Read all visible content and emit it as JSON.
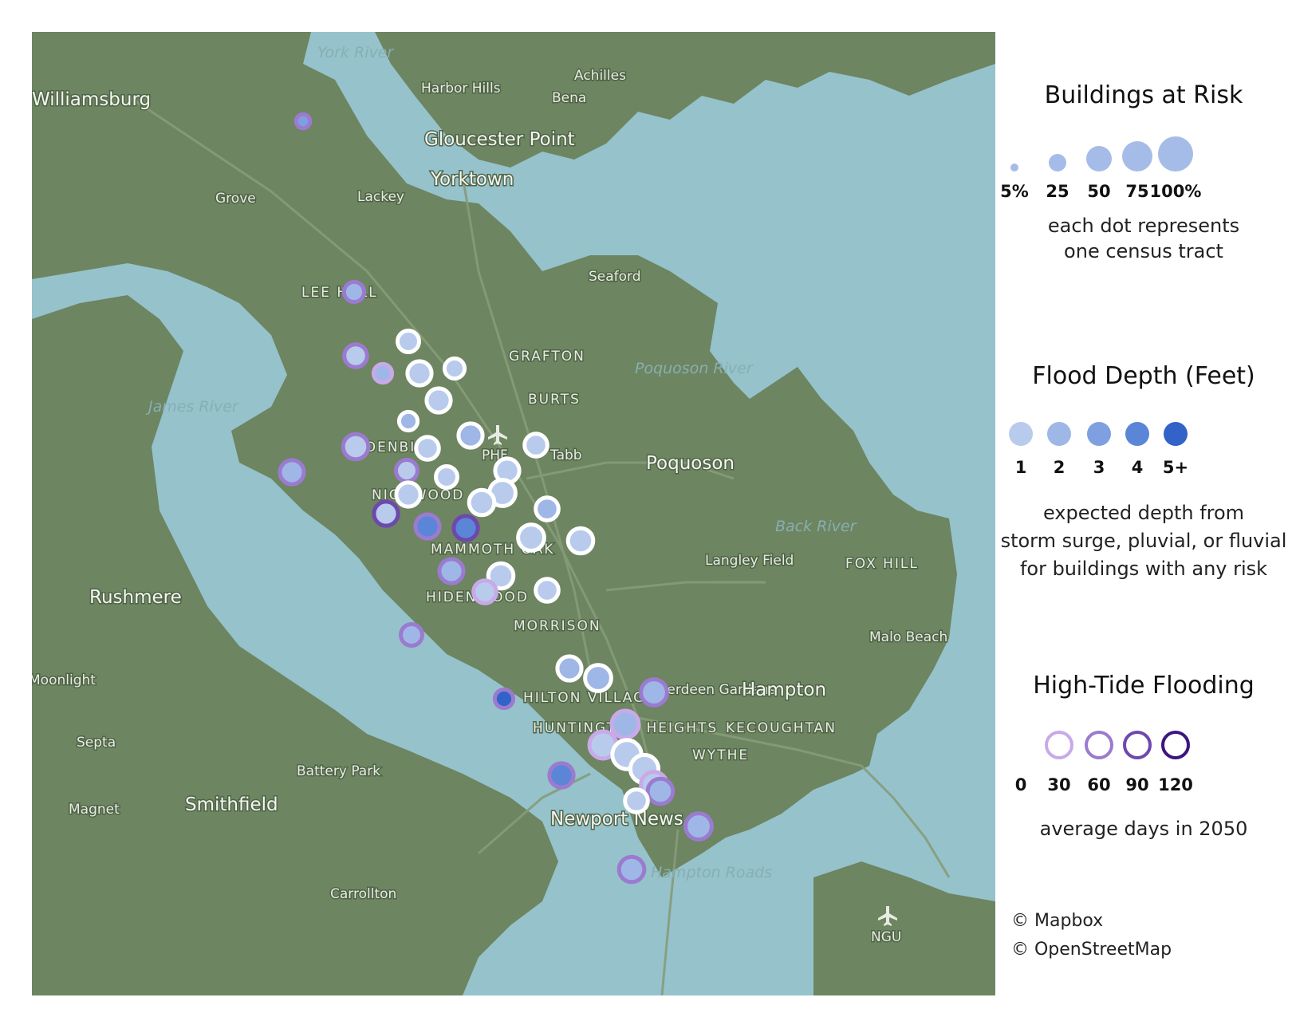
{
  "map": {
    "colors": {
      "water": "#95c2cb",
      "land": "#6d8560",
      "roads": "#869c7a",
      "label": "#e7ece2"
    },
    "place_labels": [
      {
        "text": "York River",
        "kind": "water"
      },
      {
        "text": "Harbor Hills",
        "kind": "town"
      },
      {
        "text": "Achilles",
        "kind": "town"
      },
      {
        "text": "Williamsburg",
        "kind": "town"
      },
      {
        "text": "Bena",
        "kind": "town"
      },
      {
        "text": "Gloucester Point",
        "kind": "town"
      },
      {
        "text": "Yorktown",
        "kind": "town"
      },
      {
        "text": "Grove",
        "kind": "town"
      },
      {
        "text": "Lackey",
        "kind": "town"
      },
      {
        "text": "Seaford",
        "kind": "town"
      },
      {
        "text": "LEE HALL",
        "kind": "district"
      },
      {
        "text": "GRAFTON",
        "kind": "district"
      },
      {
        "text": "Poquoson River",
        "kind": "water"
      },
      {
        "text": "James River",
        "kind": "water"
      },
      {
        "text": "BURTS",
        "kind": "district"
      },
      {
        "text": "DENBIGH",
        "kind": "district"
      },
      {
        "text": "PHF",
        "kind": "airport"
      },
      {
        "text": "Tabb",
        "kind": "town"
      },
      {
        "text": "Poquoson",
        "kind": "city"
      },
      {
        "text": "NIGHWOOD",
        "kind": "district"
      },
      {
        "text": "Back River",
        "kind": "water"
      },
      {
        "text": "MAMMOTH OAK",
        "kind": "district"
      },
      {
        "text": "Langley Field",
        "kind": "town"
      },
      {
        "text": "FOX HILL",
        "kind": "district"
      },
      {
        "text": "Rushmere",
        "kind": "town"
      },
      {
        "text": "HIDENWOOD",
        "kind": "district"
      },
      {
        "text": "MORRISON",
        "kind": "district"
      },
      {
        "text": "Malo Beach",
        "kind": "town"
      },
      {
        "text": "Moonlight",
        "kind": "town"
      },
      {
        "text": "Aberdeen Gardens",
        "kind": "town"
      },
      {
        "text": "HILTON VILLAGE",
        "kind": "district"
      },
      {
        "text": "Hampton",
        "kind": "city"
      },
      {
        "text": "HUNTINGTON HEIGHTS",
        "kind": "district"
      },
      {
        "text": "KECOUGHTAN",
        "kind": "district"
      },
      {
        "text": "Septa",
        "kind": "town"
      },
      {
        "text": "WYTHE",
        "kind": "district"
      },
      {
        "text": "Battery Park",
        "kind": "town"
      },
      {
        "text": "Magnet",
        "kind": "town"
      },
      {
        "text": "Smithfield",
        "kind": "town"
      },
      {
        "text": "Newport News",
        "kind": "city"
      },
      {
        "text": "Hampton Roads",
        "kind": "water"
      },
      {
        "text": "Carrollton",
        "kind": "town"
      },
      {
        "text": "NGU",
        "kind": "airport"
      }
    ],
    "tracts": [
      {
        "buildings_pct": 5,
        "depth_ft": 3,
        "tide_days": 60
      },
      {
        "buildings_pct": 20,
        "depth_ft": 2,
        "tide_days": 60
      },
      {
        "buildings_pct": 25,
        "depth_ft": 1,
        "tide_days": 0
      },
      {
        "buildings_pct": 30,
        "depth_ft": 1,
        "tide_days": 60
      },
      {
        "buildings_pct": 15,
        "depth_ft": 2,
        "tide_days": 30
      },
      {
        "buildings_pct": 35,
        "depth_ft": 1,
        "tide_days": 0
      },
      {
        "buildings_pct": 20,
        "depth_ft": 1,
        "tide_days": 0
      },
      {
        "buildings_pct": 35,
        "depth_ft": 1,
        "tide_days": 0
      },
      {
        "buildings_pct": 15,
        "depth_ft": 2,
        "tide_days": 0
      },
      {
        "buildings_pct": 40,
        "depth_ft": 1,
        "tide_days": 60
      },
      {
        "buildings_pct": 30,
        "depth_ft": 1,
        "tide_days": 0
      },
      {
        "buildings_pct": 35,
        "depth_ft": 2,
        "tide_days": 0
      },
      {
        "buildings_pct": 30,
        "depth_ft": 1,
        "tide_days": 0
      },
      {
        "buildings_pct": 35,
        "depth_ft": 1,
        "tide_days": 0
      },
      {
        "buildings_pct": 35,
        "depth_ft": 2,
        "tide_days": 60
      },
      {
        "buildings_pct": 25,
        "depth_ft": 1,
        "tide_days": 60
      },
      {
        "buildings_pct": 25,
        "depth_ft": 1,
        "tide_days": 0
      },
      {
        "buildings_pct": 35,
        "depth_ft": 1,
        "tide_days": 0
      },
      {
        "buildings_pct": 45,
        "depth_ft": 1,
        "tide_days": 0
      },
      {
        "buildings_pct": 40,
        "depth_ft": 1,
        "tide_days": 0
      },
      {
        "buildings_pct": 35,
        "depth_ft": 1,
        "tide_days": 90
      },
      {
        "buildings_pct": 35,
        "depth_ft": 4,
        "tide_days": 60
      },
      {
        "buildings_pct": 35,
        "depth_ft": 4,
        "tide_days": 90
      },
      {
        "buildings_pct": 30,
        "depth_ft": 2,
        "tide_days": 0
      },
      {
        "buildings_pct": 45,
        "depth_ft": 1,
        "tide_days": 0
      },
      {
        "buildings_pct": 40,
        "depth_ft": 1,
        "tide_days": 0
      },
      {
        "buildings_pct": 35,
        "depth_ft": 2,
        "tide_days": 60
      },
      {
        "buildings_pct": 40,
        "depth_ft": 1,
        "tide_days": 0
      },
      {
        "buildings_pct": 30,
        "depth_ft": 1,
        "tide_days": 30
      },
      {
        "buildings_pct": 30,
        "depth_ft": 1,
        "tide_days": 0
      },
      {
        "buildings_pct": 25,
        "depth_ft": 2,
        "tide_days": 60
      },
      {
        "buildings_pct": 35,
        "depth_ft": 2,
        "tide_days": 0
      },
      {
        "buildings_pct": 45,
        "depth_ft": 2,
        "tide_days": 0
      },
      {
        "buildings_pct": 45,
        "depth_ft": 2,
        "tide_days": 60
      },
      {
        "buildings_pct": 15,
        "depth_ft": 5,
        "tide_days": 60
      },
      {
        "buildings_pct": 50,
        "depth_ft": 2,
        "tide_days": 30
      },
      {
        "buildings_pct": 50,
        "depth_ft": 1,
        "tide_days": 30
      },
      {
        "buildings_pct": 60,
        "depth_ft": 1,
        "tide_days": 0
      },
      {
        "buildings_pct": 55,
        "depth_ft": 1,
        "tide_days": 0
      },
      {
        "buildings_pct": 45,
        "depth_ft": 1,
        "tide_days": 30
      },
      {
        "buildings_pct": 35,
        "depth_ft": 4,
        "tide_days": 60
      },
      {
        "buildings_pct": 40,
        "depth_ft": 2,
        "tide_days": 60
      },
      {
        "buildings_pct": 30,
        "depth_ft": 1,
        "tide_days": 0
      },
      {
        "buildings_pct": 45,
        "depth_ft": 2,
        "tide_days": 60
      },
      {
        "buildings_pct": 40,
        "depth_ft": 2,
        "tide_days": 60
      }
    ]
  },
  "legend": {
    "buildings": {
      "title": "Buildings at Risk",
      "labels": [
        "5%",
        "25",
        "50",
        "75",
        "100%"
      ],
      "note_line1": "each dot represents",
      "note_line2": "one census tract",
      "color": "#a6bce8"
    },
    "depth": {
      "title": "Flood Depth (Feet)",
      "labels": [
        "1",
        "2",
        "3",
        "4",
        "5+"
      ],
      "colors": [
        "#b8cbec",
        "#9fb7e6",
        "#7e9fe0",
        "#5b85d6",
        "#3163c8"
      ],
      "note_line1": "expected depth from",
      "note_line2": "storm surge, pluvial, or fluvial",
      "note_line3": "for buildings with any risk"
    },
    "tide": {
      "title": "High-Tide Flooding",
      "labels": [
        "0",
        "30",
        "60",
        "90",
        "120"
      ],
      "colors": [
        "#ffffff",
        "#c9a9e8",
        "#9b7bd0",
        "#6e48ad",
        "#3e1480"
      ],
      "note_line1": "average days in 2050"
    }
  },
  "attribution": {
    "line1": "© Mapbox",
    "line2": "© OpenStreetMap"
  }
}
